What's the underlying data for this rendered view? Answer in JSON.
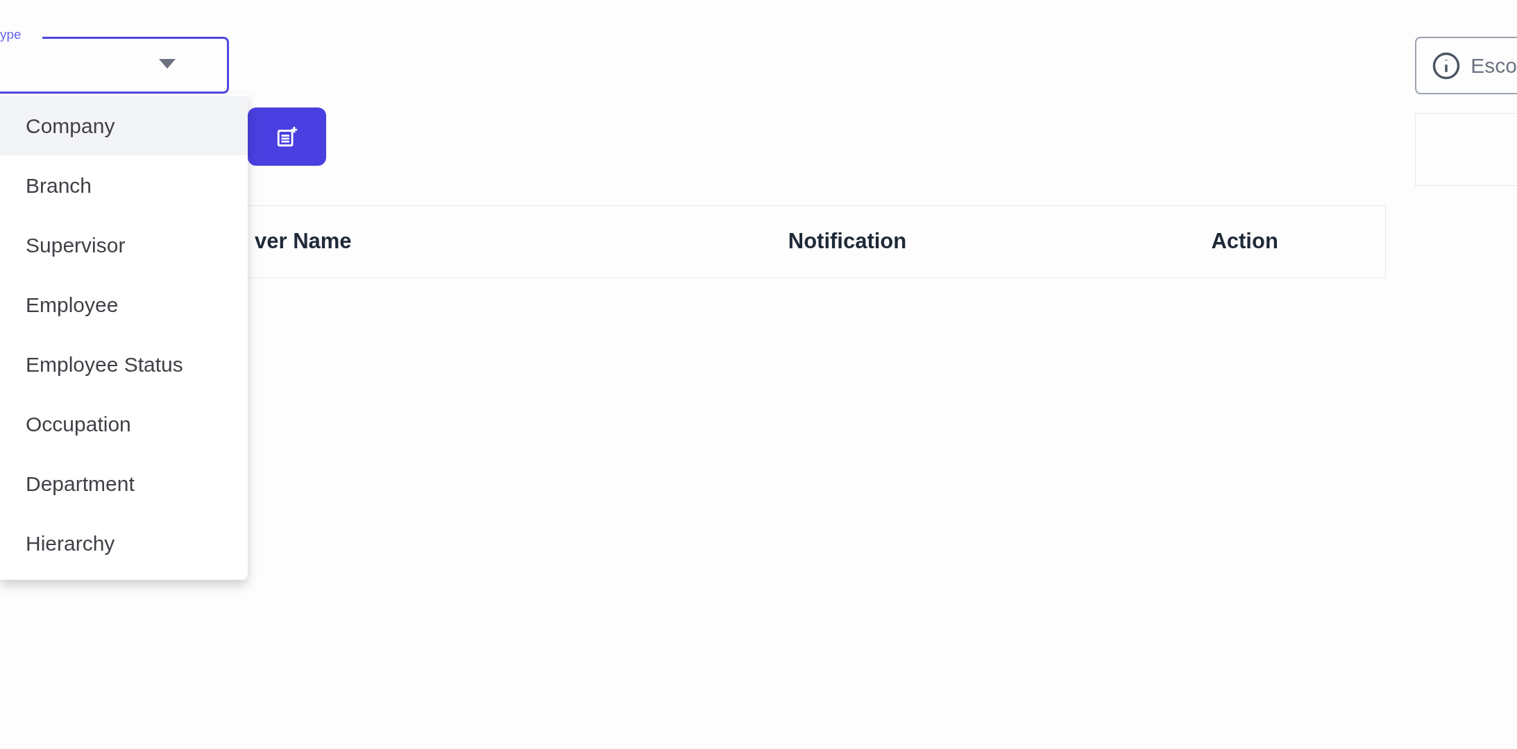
{
  "type_select": {
    "label": "ype",
    "expanded": true
  },
  "type_options": [
    {
      "label": "Company",
      "selected": true
    },
    {
      "label": "Branch",
      "selected": false
    },
    {
      "label": "Supervisor",
      "selected": false
    },
    {
      "label": "Employee",
      "selected": false
    },
    {
      "label": "Employee Status",
      "selected": false
    },
    {
      "label": "Occupation",
      "selected": false
    },
    {
      "label": "Department",
      "selected": false
    },
    {
      "label": "Hierarchy",
      "selected": false
    }
  ],
  "table": {
    "columns": [
      "ver Name",
      "Notification",
      "Action"
    ]
  },
  "notice": {
    "text": "Esco"
  }
}
